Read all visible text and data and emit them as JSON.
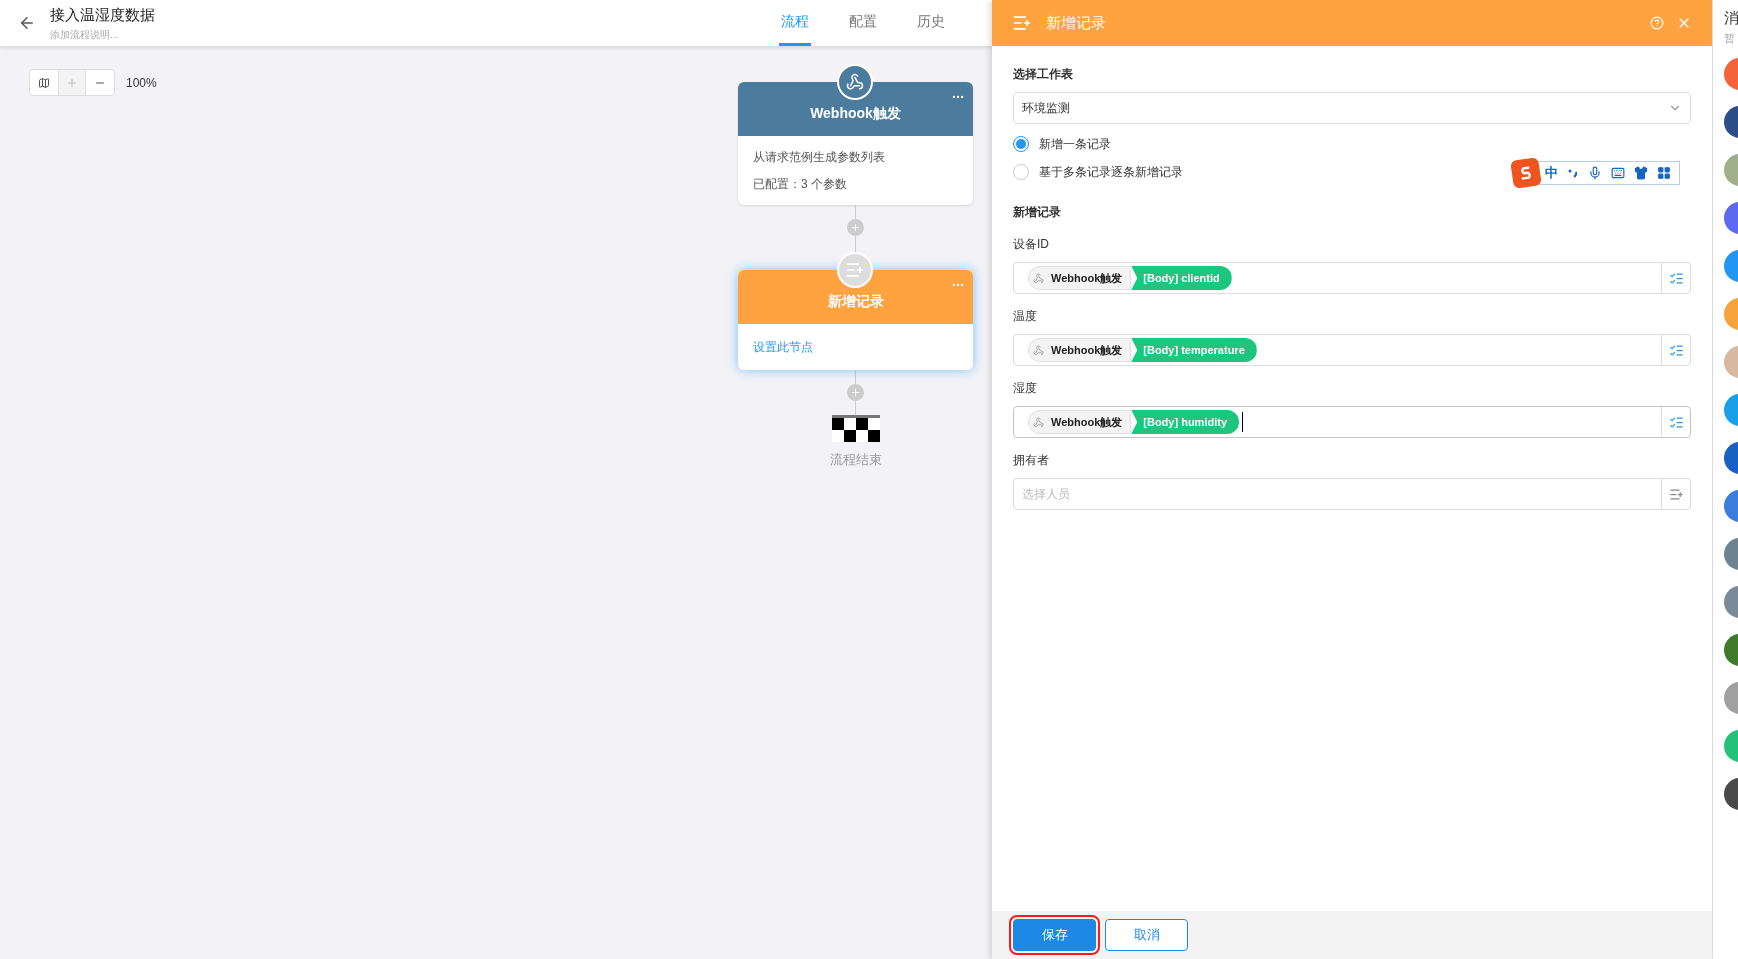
{
  "header": {
    "title": "接入温湿度数据",
    "description": "添加流程说明..."
  },
  "tabs": [
    {
      "label": "流程",
      "selected": true
    },
    {
      "label": "配置",
      "selected": false
    },
    {
      "label": "历史",
      "selected": false
    }
  ],
  "zoom_reading": "100%",
  "flow_nodes": [
    {
      "kind": "trigger",
      "title": "Webhook触发",
      "lines": [
        "从请求范例生成参数列表",
        "已配置：3 个参数"
      ],
      "selected": false
    },
    {
      "kind": "action",
      "title": "新增记录",
      "link": "设置此节点",
      "selected": true
    },
    {
      "kind": "end",
      "label": "流程结束"
    }
  ],
  "panel": {
    "title": "新增记录",
    "worksheet": {
      "label": "选择工作表",
      "value": "环境监测"
    },
    "modes": [
      {
        "label": "新增一条记录",
        "selected": true
      },
      {
        "label": "基于多条记录逐条新增记录",
        "selected": false
      }
    ],
    "section": "新增记录",
    "fields": [
      {
        "kind": "tokens",
        "label": "设备ID",
        "source": "Webhook触发",
        "token": "[Body] clientid",
        "focused": false
      },
      {
        "kind": "tokens",
        "label": "温度",
        "source": "Webhook触发",
        "token": "[Body] temperature",
        "focused": false
      },
      {
        "kind": "tokens",
        "label": "湿度",
        "source": "Webhook触发",
        "token": "[Body] humidity",
        "focused": true
      },
      {
        "kind": "picker",
        "label": "拥有者",
        "placeholder": "选择人员"
      }
    ],
    "buttons": [
      {
        "kind": "primary",
        "label": "保存",
        "outlined": true
      },
      {
        "kind": "secondary",
        "label": "取消",
        "outlined": false
      }
    ]
  },
  "ime_toolbar": {
    "glyph": "中"
  },
  "sidebar": {
    "title": "消",
    "subtitle": "暂",
    "avatars": [
      {
        "color": "#f4623a"
      },
      {
        "color": "#2c4f8a"
      },
      {
        "color": "#9fb08a"
      },
      {
        "color": "#5b6af0"
      },
      {
        "color": "#2196f3"
      },
      {
        "color": "#f5a33a"
      },
      {
        "color": "#d9b8a0"
      },
      {
        "color": "#1aa0e8"
      },
      {
        "color": "#1a5fc4"
      },
      {
        "color": "#3b7ddc"
      },
      {
        "color": "#6d8391"
      },
      {
        "color": "#7a8a99"
      },
      {
        "color": "#3e7a2a"
      },
      {
        "color": "#a0a0a0"
      },
      {
        "color": "#22c27a"
      },
      {
        "color": "#4a4a4a"
      }
    ]
  }
}
